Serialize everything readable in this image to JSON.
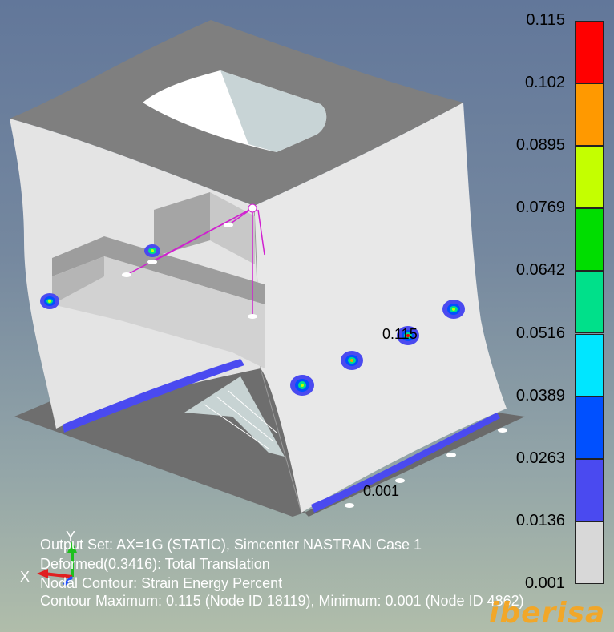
{
  "view": {
    "legend": {
      "values": [
        "0.115",
        "0.102",
        "0.0895",
        "0.0769",
        "0.0642",
        "0.0516",
        "0.0389",
        "0.0263",
        "0.0136",
        "0.001"
      ],
      "colors": [
        "#ff0000",
        "#ff9900",
        "#c4ff00",
        "#00dd00",
        "#00e08a",
        "#00e6ff",
        "#0050ff",
        "#4a4af0",
        "#d8d8d8"
      ]
    },
    "info": {
      "line1": "Output Set: AX=1G (STATIC), Simcenter NASTRAN Case 1",
      "line2": "Deformed(0.3416): Total Translation",
      "line3": "Nodal Contour: Strain Energy Percent",
      "line4": "Contour Maximum: 0.115 (Node ID 18119), Minimum: 0.001 (Node ID 4862)"
    },
    "annotations": {
      "max_label": "0.115",
      "min_label": "0.001"
    },
    "axes": {
      "x": "X",
      "y": "Y"
    },
    "watermark": "iberisa"
  }
}
